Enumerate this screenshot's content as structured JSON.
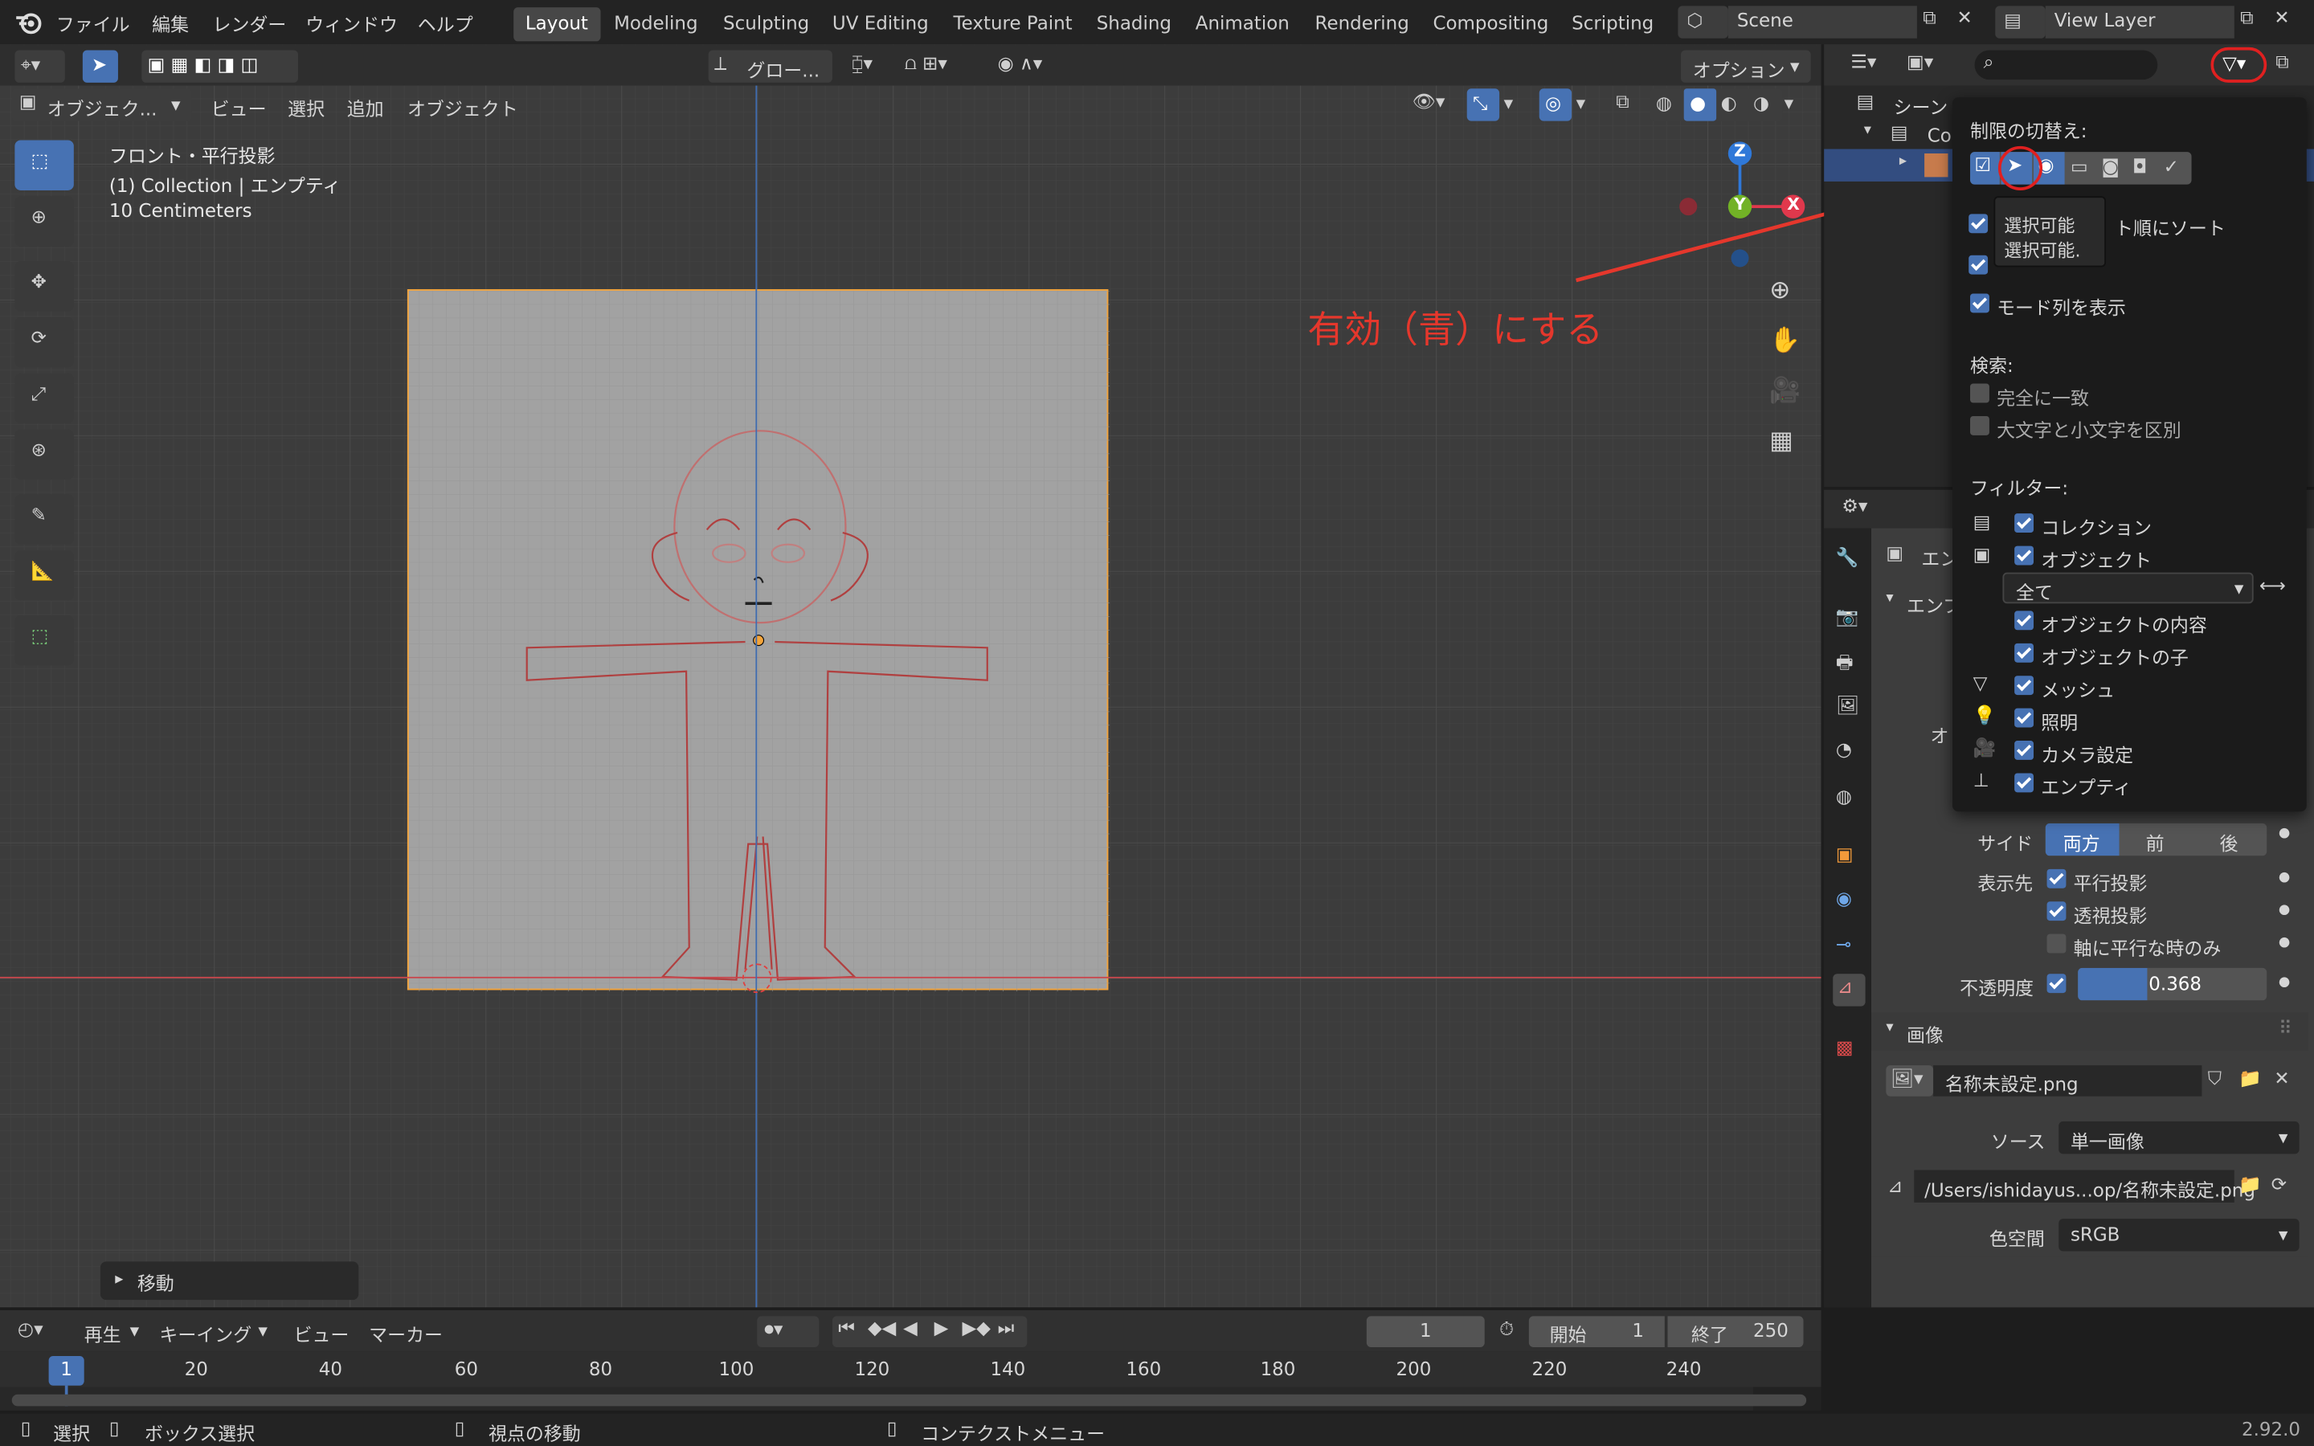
{
  "topbar": {
    "menus": [
      "ファイル",
      "編集",
      "レンダー",
      "ウィンドウ",
      "ヘルプ"
    ],
    "workspaces": [
      "Layout",
      "Modeling",
      "Sculpting",
      "UV Editing",
      "Texture Paint",
      "Shading",
      "Animation",
      "Rendering",
      "Compositing",
      "Scripting"
    ],
    "active_workspace": "Layout",
    "scene": "Scene",
    "view_layer": "View Layer"
  },
  "viewport_header": {
    "transform_orientation": "グロー...",
    "options": "オプション",
    "mode": "オブジェク...",
    "menus": [
      "ビュー",
      "選択",
      "追加",
      "オブジェクト"
    ]
  },
  "viewport": {
    "view_name": "フロント・平行投影",
    "collection_info": "(1) Collection | エンプティ",
    "scale": "10 Centimeters",
    "operator_panel": "移動"
  },
  "gizmo": {
    "z": "Z",
    "y": "Y",
    "x": "X"
  },
  "annotation": {
    "text": "有効（青）にする",
    "color": "#e5372c"
  },
  "outliner": {
    "row0": "シーン",
    "row1": "Coll"
  },
  "filter_popup": {
    "restriction_label": "制限の切替え:",
    "tooltip_title": "選択可能",
    "tooltip_desc": "選択可能.",
    "sort_label": "ト順にソート",
    "show_mode_column": "モード列を表示",
    "search_label": "検索:",
    "exact_match": "完全に一致",
    "case_sensitive": "大文字と小文字を区別",
    "filter_label": "フィルター:",
    "collections": "コレクション",
    "objects": "オブジェクト",
    "object_type": "全て",
    "object_contents": "オブジェクトの内容",
    "object_children": "オブジェクトの子",
    "meshes": "メッシュ",
    "lights": "照明",
    "cameras": "カメラ設定",
    "empties": "エンプティ"
  },
  "properties": {
    "header_partial": "エン",
    "panel_partial": "エンプ",
    "obj_partial": "オ",
    "side_label": "サイド",
    "side_options": [
      "両方",
      "前",
      "後"
    ],
    "display_label": "表示先",
    "ortho": "平行投影",
    "persp": "透視投影",
    "axis_aligned": "軸に平行な時のみ",
    "opacity_label": "不透明度",
    "opacity_value": "0.368",
    "opacity_fraction": 0.368,
    "image_panel": "画像",
    "image_name": "名称未設定.png",
    "source_label": "ソース",
    "source_value": "単一画像",
    "filepath": "/Users/ishidayus...op/名称未設定.png",
    "colorspace_label": "色空間",
    "colorspace_value": "sRGB"
  },
  "timeline": {
    "menus": [
      "再生",
      "キーイング",
      "ビュー",
      "マーカー"
    ],
    "current_frame": "1",
    "start_label": "開始",
    "start": "1",
    "end_label": "終了",
    "end": "250",
    "ruler": [
      "20",
      "40",
      "60",
      "80",
      "100",
      "120",
      "140",
      "160",
      "180",
      "200",
      "220",
      "240"
    ],
    "playhead": "1"
  },
  "statusbar": {
    "select": "選択",
    "box_select": "ボックス選択",
    "rotate_view": "視点の移動",
    "context_menu": "コンテクストメニュー",
    "version": "2.92.0"
  },
  "colors": {
    "accent": "#4772b3",
    "selection_orange": "#f4a43a",
    "header": "#303030",
    "panel": "#3d3d3d"
  }
}
